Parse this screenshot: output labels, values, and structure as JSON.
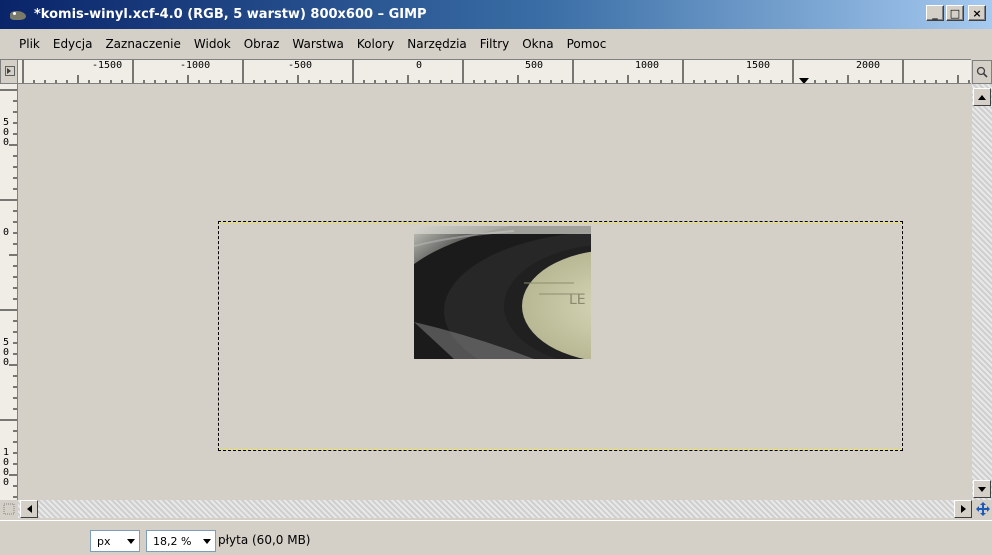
{
  "window": {
    "title": "*komis-winyl.xcf-4.0 (RGB, 5 warstw) 800x600 – GIMP",
    "minimize_glyph": "_",
    "maximize_glyph": "□",
    "close_glyph": "×"
  },
  "menu": [
    "Plik",
    "Edycja",
    "Zaznaczenie",
    "Widok",
    "Obraz",
    "Warstwa",
    "Kolory",
    "Narzędzia",
    "Filtry",
    "Okna",
    "Pomoc"
  ],
  "ruler_horizontal_labels": [
    "-1500",
    "-1000",
    "-500",
    "0",
    "500",
    "1000",
    "1500",
    "2000"
  ],
  "ruler_vertical_labels": [
    "500",
    "0",
    "500",
    "1000"
  ],
  "status": {
    "unit": "px",
    "zoom": "18,2 %",
    "message": "płyta (60,0 MB)"
  },
  "icons": {
    "app": "gimp-wilber-icon",
    "zoom_toggle": "magnifier-icon",
    "navigate": "navigate-cross-icon",
    "scroll_up": "arrow-up-icon",
    "scroll_down": "arrow-down-icon",
    "scroll_left": "arrow-left-icon",
    "scroll_right": "arrow-right-icon"
  },
  "colors": {
    "titlebar_start": "#0a246a",
    "titlebar_end": "#a6caf0",
    "window_bg": "#d4d0c8",
    "selection_marching_ants": "#f4e842"
  }
}
